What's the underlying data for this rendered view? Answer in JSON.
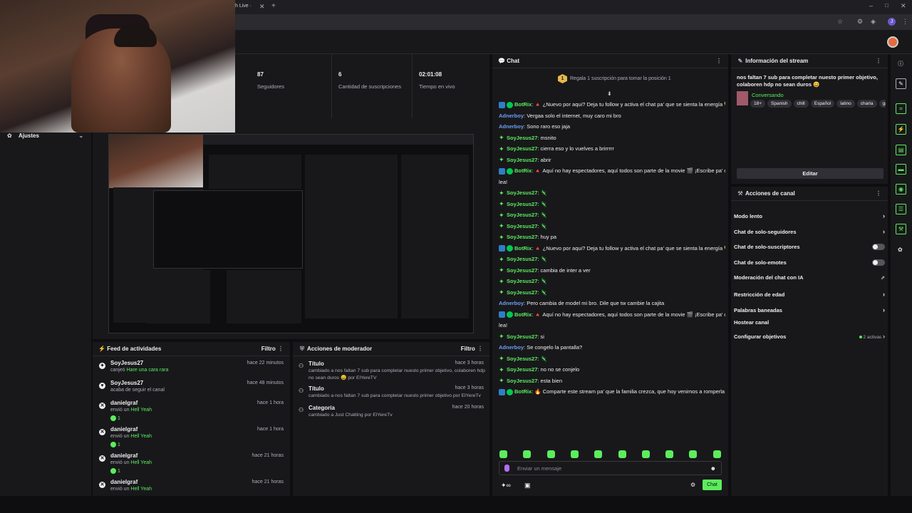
{
  "browser": {
    "tab_title": "h Live ·",
    "avatar_letter": "J"
  },
  "stats": [
    {
      "value": "87",
      "label": "Seguidores"
    },
    {
      "value": "6",
      "label": "Cantidad de suscripciones"
    },
    {
      "value": "02:01:08",
      "label": "Tiempo en vivo"
    }
  ],
  "settings": {
    "label": "Ajustes"
  },
  "activity_feed": {
    "title": "Feed de actividades",
    "filter_label": "Filtro",
    "items": [
      {
        "name": "SoyJesus27",
        "desc_prefix": "canjeó",
        "desc_highlight": "Hare una cara rara",
        "desc_suffix": "",
        "time": "hace 22 minutos",
        "icon": "reward-icon",
        "count": ""
      },
      {
        "name": "SoyJesus27",
        "desc_prefix": "acaba de seguir el canal",
        "desc_highlight": "",
        "desc_suffix": "",
        "time": "hace 48 minutos",
        "icon": "heart-icon",
        "count": ""
      },
      {
        "name": "danielgraf",
        "desc_prefix": "envió un",
        "desc_highlight": "Hell Yeah",
        "desc_suffix": "",
        "time": "hace 1 hora",
        "icon": "x-circle-icon",
        "count": "1"
      },
      {
        "name": "danielgraf",
        "desc_prefix": "envió un",
        "desc_highlight": "Hell Yeah",
        "desc_suffix": "",
        "time": "hace 1 hora",
        "icon": "x-circle-icon",
        "count": "1"
      },
      {
        "name": "danielgraf",
        "desc_prefix": "envió un",
        "desc_highlight": "Hell Yeah",
        "desc_suffix": "",
        "time": "hace 21 horas",
        "icon": "x-circle-icon",
        "count": "1"
      },
      {
        "name": "danielgraf",
        "desc_prefix": "envió un",
        "desc_highlight": "Hell Yeah",
        "desc_suffix": "",
        "time": "hace 21 horas",
        "icon": "x-circle-icon",
        "count": ""
      }
    ]
  },
  "mod_actions": {
    "title": "Acciones de moderador",
    "filter_label": "Filtro",
    "items": [
      {
        "type": "Título",
        "line1": "cambiado a nos faltan 7 sub para completar nuesto primer objetivo, colaboren hdp",
        "line2": "no sean duros 😄 por ElYereTV",
        "time": "hace 3 horas"
      },
      {
        "type": "Título",
        "line1": "cambiado a nos faltan 7 sub para completar nuesto primer objetivo por ElYereTv",
        "line2": "",
        "time": "hace 3 horas"
      },
      {
        "type": "Categoría",
        "line1": "cambiado a Just Chatting por ElYereTv",
        "line2": "",
        "time": "hace 20 horas"
      }
    ]
  },
  "chat": {
    "title": "Chat",
    "gift_banner": "Regala 1 suscripción para tomar la posición 1",
    "gift_rank": "1",
    "input_placeholder": "Enviar un mensaje",
    "send_label": "Chat",
    "messages": [
      {
        "user": "BotRix",
        "color": "#5ced5c",
        "badges": "mod-ver",
        "text": "🔺 ¿Nuevo por aqui? Deja tu follow y activa el chat pa' que se sienta la energía 💚"
      },
      {
        "user": "Adnerboy",
        "color": "#6a9ff5",
        "badges": "",
        "text": "Vergaa solo el internet, muy caro mi bro"
      },
      {
        "user": "Adnerboy",
        "color": "#6a9ff5",
        "badges": "",
        "text": "Sono raro eso jaja"
      },
      {
        "user": "SoyJesus27",
        "color": "#5ced5c",
        "badges": "star",
        "text": "msnito"
      },
      {
        "user": "SoyJesus27",
        "color": "#5ced5c",
        "badges": "star",
        "text": "cierra eso y lo vuelves a brirrrrr"
      },
      {
        "user": "SoyJesus27",
        "color": "#5ced5c",
        "badges": "star",
        "text": "abrir"
      },
      {
        "user": "BotRix",
        "color": "#5ced5c",
        "badges": "mod-ver",
        "text": "🔺 Aquí no hay espectadores, aquí todos son parte de la movie 🎬 ¡Escribe pa' que te"
      },
      {
        "user": "",
        "color": "#efeff1",
        "badges": "",
        "text": "lea!"
      },
      {
        "user": "SoyJesus27",
        "color": "#5ced5c",
        "badges": "star",
        "text": "🦎"
      },
      {
        "user": "SoyJesus27",
        "color": "#5ced5c",
        "badges": "star",
        "text": "🦎"
      },
      {
        "user": "SoyJesus27",
        "color": "#5ced5c",
        "badges": "star",
        "text": "🦎"
      },
      {
        "user": "SoyJesus27",
        "color": "#5ced5c",
        "badges": "star",
        "text": "🦎"
      },
      {
        "user": "SoyJesus27",
        "color": "#5ced5c",
        "badges": "star",
        "text": "huy pa"
      },
      {
        "user": "BotRix",
        "color": "#5ced5c",
        "badges": "mod-ver",
        "text": "🔺 ¿Nuevo por aqui? Deja tu follow y activa el chat pa' que se sienta la energía 💚"
      },
      {
        "user": "SoyJesus27",
        "color": "#5ced5c",
        "badges": "star",
        "text": "🦎"
      },
      {
        "user": "SoyJesus27",
        "color": "#5ced5c",
        "badges": "star",
        "text": "cambia de inter a ver"
      },
      {
        "user": "SoyJesus27",
        "color": "#5ced5c",
        "badges": "star",
        "text": "🦎"
      },
      {
        "user": "SoyJesus27",
        "color": "#5ced5c",
        "badges": "star",
        "text": "🦎"
      },
      {
        "user": "Adnerboy",
        "color": "#6a9ff5",
        "badges": "",
        "text": "Pero cambia de model mi bro. Dile que tw cambie la cajita"
      },
      {
        "user": "BotRix",
        "color": "#5ced5c",
        "badges": "mod-ver",
        "text": "🔺 Aquí no hay espectadores, aquí todos son parte de la movie 🎬 ¡Escribe pa' que te"
      },
      {
        "user": "",
        "color": "#efeff1",
        "badges": "",
        "text": "lea!"
      },
      {
        "user": "SoyJesus27",
        "color": "#5ced5c",
        "badges": "star",
        "text": "si"
      },
      {
        "user": "Adnerboy",
        "color": "#6a9ff5",
        "badges": "",
        "text": "Se congelo la pantalla?"
      },
      {
        "user": "SoyJesus27",
        "color": "#5ced5c",
        "badges": "star",
        "text": "🦎"
      },
      {
        "user": "SoyJesus27",
        "color": "#5ced5c",
        "badges": "star",
        "text": "no no se conjelo"
      },
      {
        "user": "SoyJesus27",
        "color": "#5ced5c",
        "badges": "star",
        "text": "esta bien"
      },
      {
        "user": "BotRix",
        "color": "#5ced5c",
        "badges": "mod-ver",
        "text": "🔥 Comparte este stream pa' que la familia crezca, que hoy venimos a romperla 🚀"
      }
    ]
  },
  "stream_info": {
    "title": "Información del stream",
    "stream_title": "nos faltan 7 sub para completar nuesto primer objetivo, colaboren hdp no sean duros 😄",
    "category": "Conversando",
    "tags": [
      "18+",
      "Spanish",
      "chill",
      "Español",
      "latino",
      "charla",
      "ga"
    ],
    "edit_label": "Editar"
  },
  "channel_actions": {
    "title": "Acciones de canal",
    "items": [
      {
        "label": "Modo lento",
        "control": "chevron"
      },
      {
        "label": "Chat de solo-seguidores",
        "control": "chevron"
      },
      {
        "label": "Chat de solo-suscriptores",
        "control": "toggle"
      },
      {
        "label": "Chat de solo-emotes",
        "control": "toggle"
      },
      {
        "label": "Moderación del chat con IA",
        "control": "external"
      },
      {
        "label": "Restricción de edad",
        "control": "chevron"
      },
      {
        "label": "Palabras baneadas",
        "control": "chevron"
      },
      {
        "label": "Hostear canal",
        "control": "none"
      },
      {
        "label": "Configurar objetivos",
        "control": "chevron"
      }
    ],
    "objectives_status": "2 activas"
  },
  "colors": {
    "accent": "#5ced5c",
    "panel": "#18181b",
    "bg": "#0e0e10"
  }
}
